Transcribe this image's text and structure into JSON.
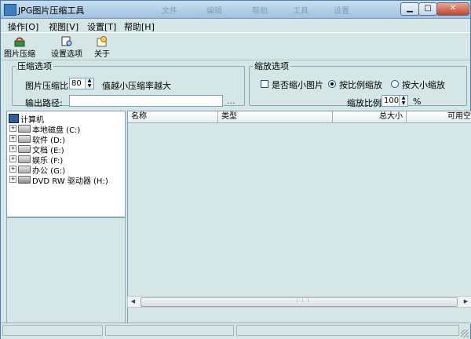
{
  "window": {
    "title": "JPG图片压缩工具"
  },
  "titlebar_blur": [
    "文件",
    "编辑",
    "帮助",
    "工具",
    "设置"
  ],
  "menu": [
    "操作[O]",
    "视图[V]",
    "设置[T]",
    "帮助[H]"
  ],
  "toolbar": {
    "compress_label": "图片压缩",
    "settings_label": "设置选项",
    "about_label": "关于"
  },
  "compress_opts": {
    "legend": "压缩选项",
    "ratio_label": "图片压缩比",
    "ratio_value": "80",
    "hint": "值越小压缩率越大",
    "path_label": "输出路径:",
    "path_value": "",
    "browse": "..."
  },
  "scale_opts": {
    "legend": "缩放选项",
    "shrink_label": "是否缩小图片",
    "by_ratio_label": "按比例缩放",
    "by_size_label": "按大小缩放",
    "ratio_label": "缩放比例",
    "ratio_value": "100",
    "percent": "%"
  },
  "tree": {
    "root": "计算机",
    "drives": [
      {
        "label": "本地磁盘 (C:)"
      },
      {
        "label": "软件 (D:)"
      },
      {
        "label": "文档 (E:)"
      },
      {
        "label": "娱乐 (F:)"
      },
      {
        "label": "办公 (G:)"
      },
      {
        "label": "DVD RW 驱动器 (H:)"
      }
    ]
  },
  "list": {
    "columns": [
      "名称",
      "类型",
      "总大小",
      "可用空"
    ]
  },
  "scrollbar": {
    "thumb_glyph": "⋮⋮⋮"
  }
}
